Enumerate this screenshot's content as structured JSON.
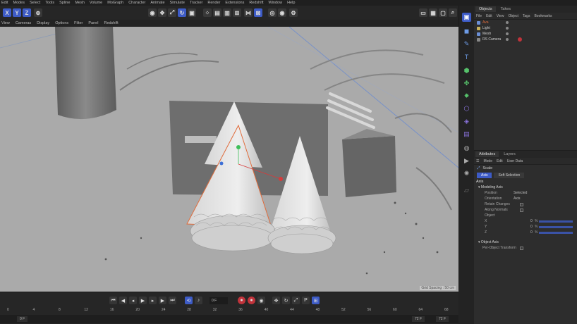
{
  "menubar": [
    "Edit",
    "Modes",
    "Select",
    "Tools",
    "Spline",
    "Mesh",
    "Volume",
    "MoGraph",
    "Character",
    "Animate",
    "Simulate",
    "Tracker",
    "Render",
    "Extensions",
    "Redshift",
    "Window",
    "Help"
  ],
  "toolbar": {
    "x_label": "X",
    "y_label": "Y",
    "z_label": "Z"
  },
  "viewport_menu": [
    "View",
    "Cameras",
    "Display",
    "Options",
    "Filter",
    "Panel",
    "Redshift"
  ],
  "viewport": {
    "grid_spacing": "Grid Spacing : 50 cm"
  },
  "object_manager": {
    "tabs": [
      "Objects",
      "Takes"
    ],
    "menu": [
      "File",
      "Edit",
      "View",
      "Object",
      "Tags",
      "Bookmarks"
    ],
    "objects": [
      {
        "name": "Ava",
        "selected": true
      },
      {
        "name": "Light",
        "selected": false
      },
      {
        "name": "Mesh",
        "selected": false
      },
      {
        "name": "RS Camera",
        "selected": false
      }
    ]
  },
  "attributes": {
    "tabs": [
      "Attributes",
      "Layers"
    ],
    "menu": [
      "Mode",
      "Edit",
      "User Data"
    ],
    "object_name": "Scale",
    "sub_tabs": [
      "Axis",
      "Soft Selection"
    ],
    "section_title": "Axis",
    "modeling_axis": {
      "title": "Modeling Axis",
      "props": [
        {
          "label": "Position",
          "value": "Selected"
        },
        {
          "label": "Orientation",
          "value": "Axis"
        },
        {
          "label": "Retain Changes",
          "value": ""
        },
        {
          "label": "Along Normals",
          "value": ""
        },
        {
          "label": "Object",
          "value": ""
        }
      ],
      "axes": [
        {
          "label": "X",
          "value": "0",
          "unit": "%"
        },
        {
          "label": "Y",
          "value": "0",
          "unit": "%"
        },
        {
          "label": "Z",
          "value": "0",
          "unit": "%"
        }
      ]
    },
    "object_axis": {
      "title": "Object Axis",
      "per_object_label": "Per-Object Transform"
    }
  },
  "timeline": {
    "current_frame": "0 F",
    "ruler_ticks": [
      "0",
      "4",
      "8",
      "12",
      "16",
      "20",
      "24",
      "28",
      "32",
      "36",
      "40",
      "44",
      "48",
      "52",
      "56",
      "60",
      "64",
      "68"
    ],
    "start_field": "0 F",
    "end_field": "72 F",
    "end_field2": "72 F"
  },
  "colors": {
    "accent": "#3d5bc6",
    "record": "#c0333b",
    "selected_object": "#e06c3c"
  }
}
